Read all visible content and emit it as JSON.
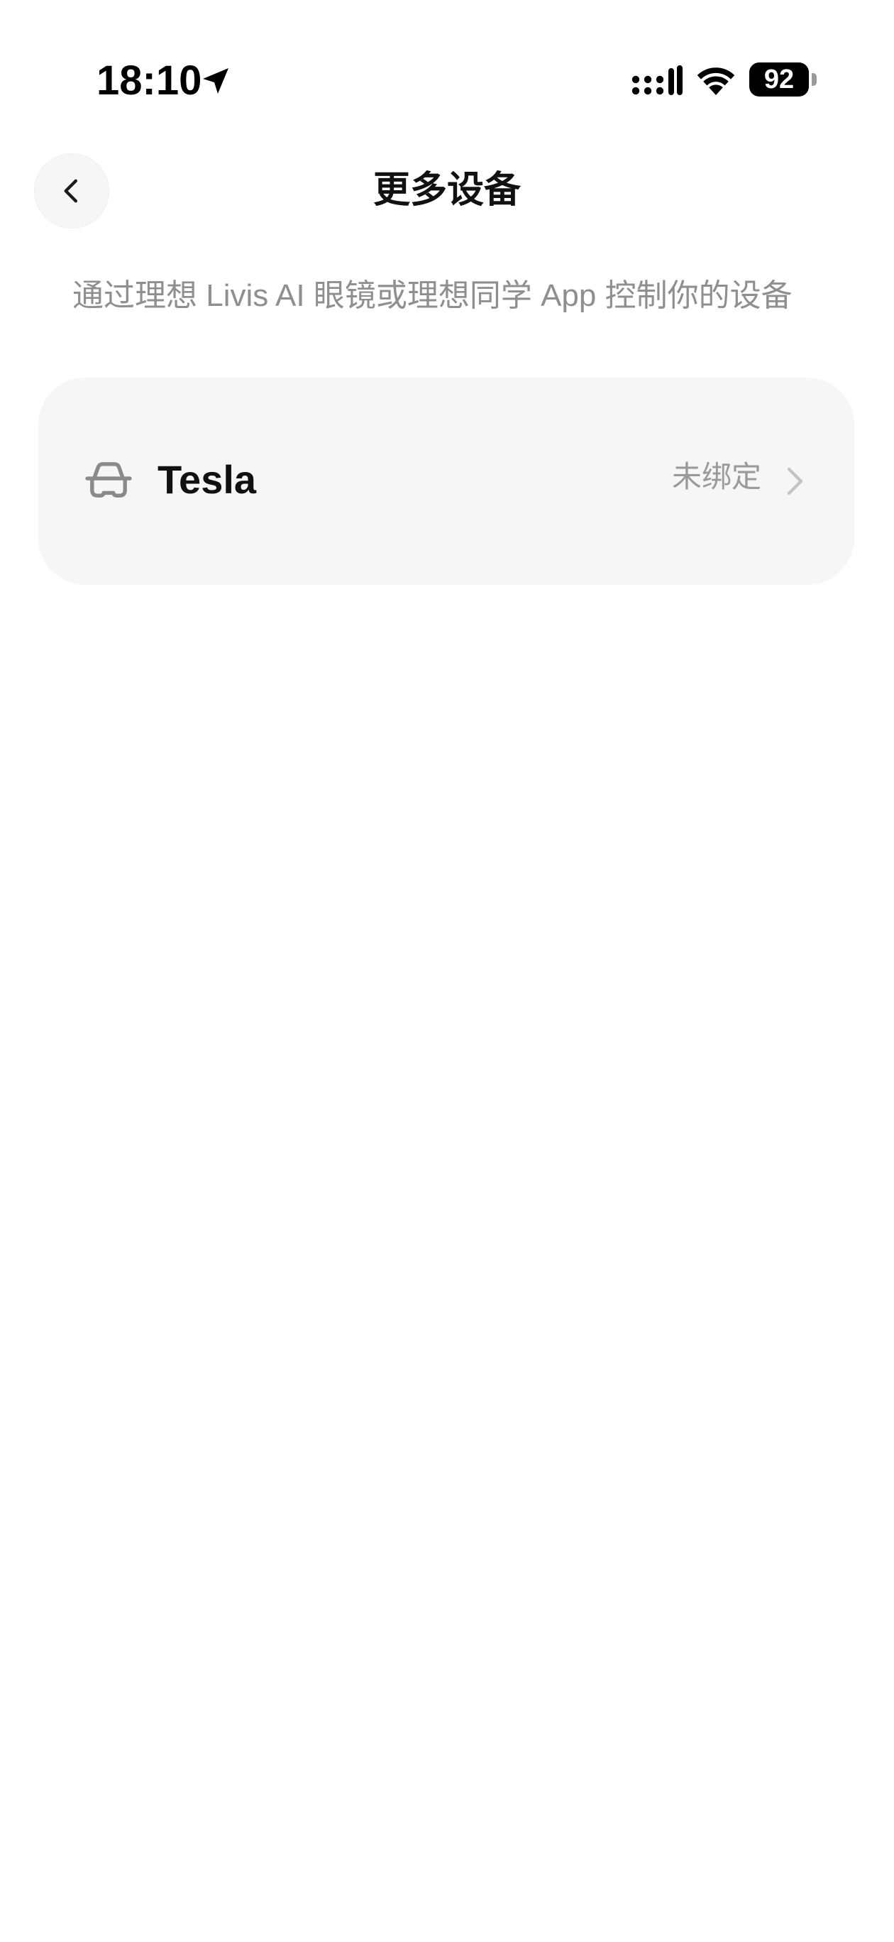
{
  "status_bar": {
    "time": "18:10",
    "battery_level": "92",
    "icons": [
      "location-arrow-icon",
      "cellular-signal-icon",
      "wifi-icon",
      "battery-icon"
    ]
  },
  "header": {
    "title": "更多设备",
    "back_icon": "chevron-left-icon"
  },
  "description": "通过理想 Livis AI 眼镜或理想同学 App 控制你的设备",
  "devices": [
    {
      "name": "Tesla",
      "status": "未绑定",
      "icon": "car-icon",
      "action_icon": "chevron-right-icon"
    }
  ],
  "colors": {
    "background": "#ffffff",
    "card_background": "#f6f6f6",
    "primary_text": "#111111",
    "secondary_text": "#8f8f8f"
  }
}
